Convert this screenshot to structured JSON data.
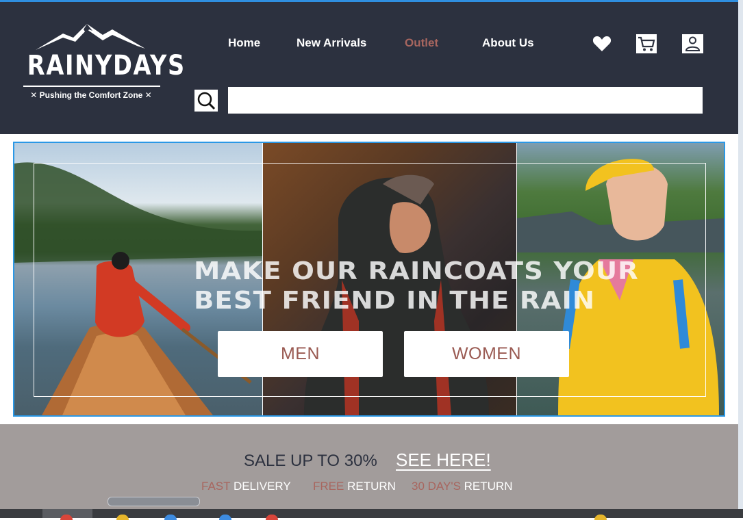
{
  "brand": {
    "name": "RAINYDAYS",
    "tagline": "Pushing the Comfort Zone"
  },
  "nav": {
    "items": [
      {
        "label": "Home"
      },
      {
        "label": "New Arrivals"
      },
      {
        "label": "Outlet",
        "color": "#a8665f"
      },
      {
        "label": "About Us"
      }
    ]
  },
  "icons": {
    "favorites": "heart-icon",
    "cart": "cart-icon",
    "account": "user-icon",
    "search": "search-icon"
  },
  "search": {
    "value": "",
    "placeholder": ""
  },
  "hero": {
    "headline_line1": "MAKE OUR RAINCOATS YOUR",
    "headline_line2": "BEST FRIEND IN THE RAIN",
    "buttons": {
      "men": "MEN",
      "women": "WOMEN"
    }
  },
  "sale": {
    "text": "SALE UP TO 30%",
    "link": "SEE HERE!",
    "perks": [
      {
        "accent": "FAST",
        "text": "DELIVERY"
      },
      {
        "accent": "FREE",
        "text": "RETURN"
      },
      {
        "accent": "30 DAY'S",
        "text": "RETURN"
      }
    ]
  },
  "colors": {
    "header_bg": "#2c313f",
    "accent": "#a8665f",
    "band_bg": "#a29c9b",
    "hero_border": "#2a98e6"
  }
}
